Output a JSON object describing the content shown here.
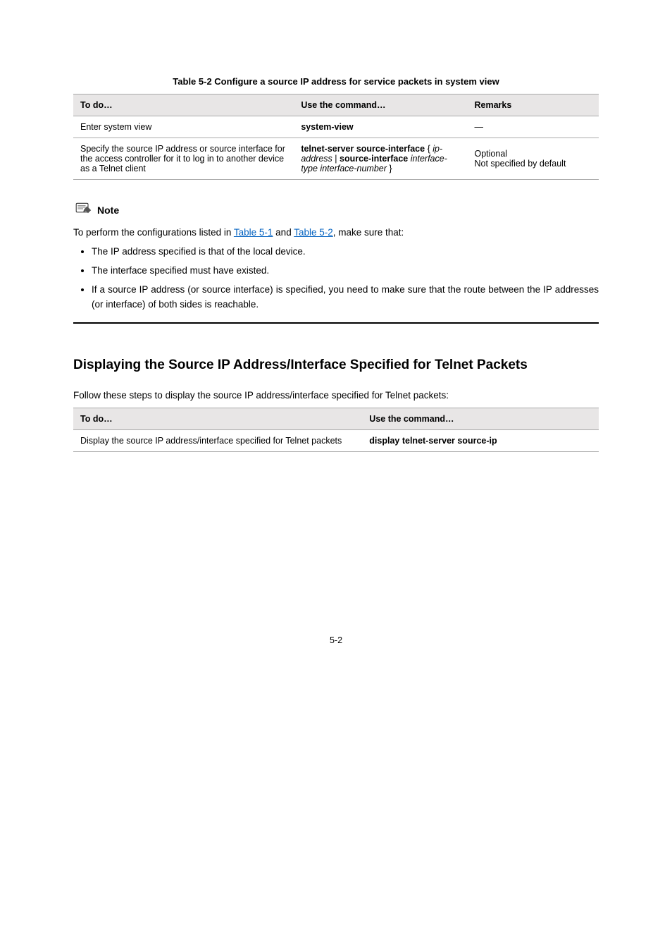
{
  "table1": {
    "caption": "Table 5-2 Configure a source IP address for service packets in system view",
    "headers": [
      "To do…",
      "Use the command…",
      "Remarks"
    ],
    "rows": [
      {
        "todo": "Enter system view",
        "cmd_bold": "system-view",
        "cmd_arg": "",
        "remarks": "—"
      },
      {
        "todo": "Specify the source IP address or source interface for the access controller for it to log in to another device as a Telnet client",
        "cmd_html": "<span class='cmd'>telnet-server source-interface </span>{ <span class='arg'>ip-address</span> | <span class='cmd'>source-interface</span> <span class='arg'>interface-type interface-number</span> }",
        "remarks_line1": "Optional",
        "remarks_line2": "Not specified by default"
      }
    ]
  },
  "note": {
    "label": "Note",
    "intro_pre": "To perform the configurations listed in ",
    "link1": "Table 5-1",
    "intro_mid": " and ",
    "link2": "Table 5-2",
    "intro_post": ", make sure that:",
    "bullets": [
      "The IP address specified is that of the local device.",
      "The interface specified must have existed.",
      "If a source IP address (or source interface) is specified, you need to make sure that the route between the IP addresses (or interface) of both sides is reachable."
    ]
  },
  "section_heading": "Displaying the Source IP Address/Interface Specified for Telnet Packets",
  "display_intro": "Follow these steps to display the source IP address/interface specified for Telnet packets:",
  "table2": {
    "headers": [
      "To do…",
      "Use the command…"
    ],
    "row": {
      "todo": "Display the source IP address/interface specified for Telnet packets",
      "cmd": "display telnet-server source-ip"
    }
  },
  "page_number": "5-2"
}
